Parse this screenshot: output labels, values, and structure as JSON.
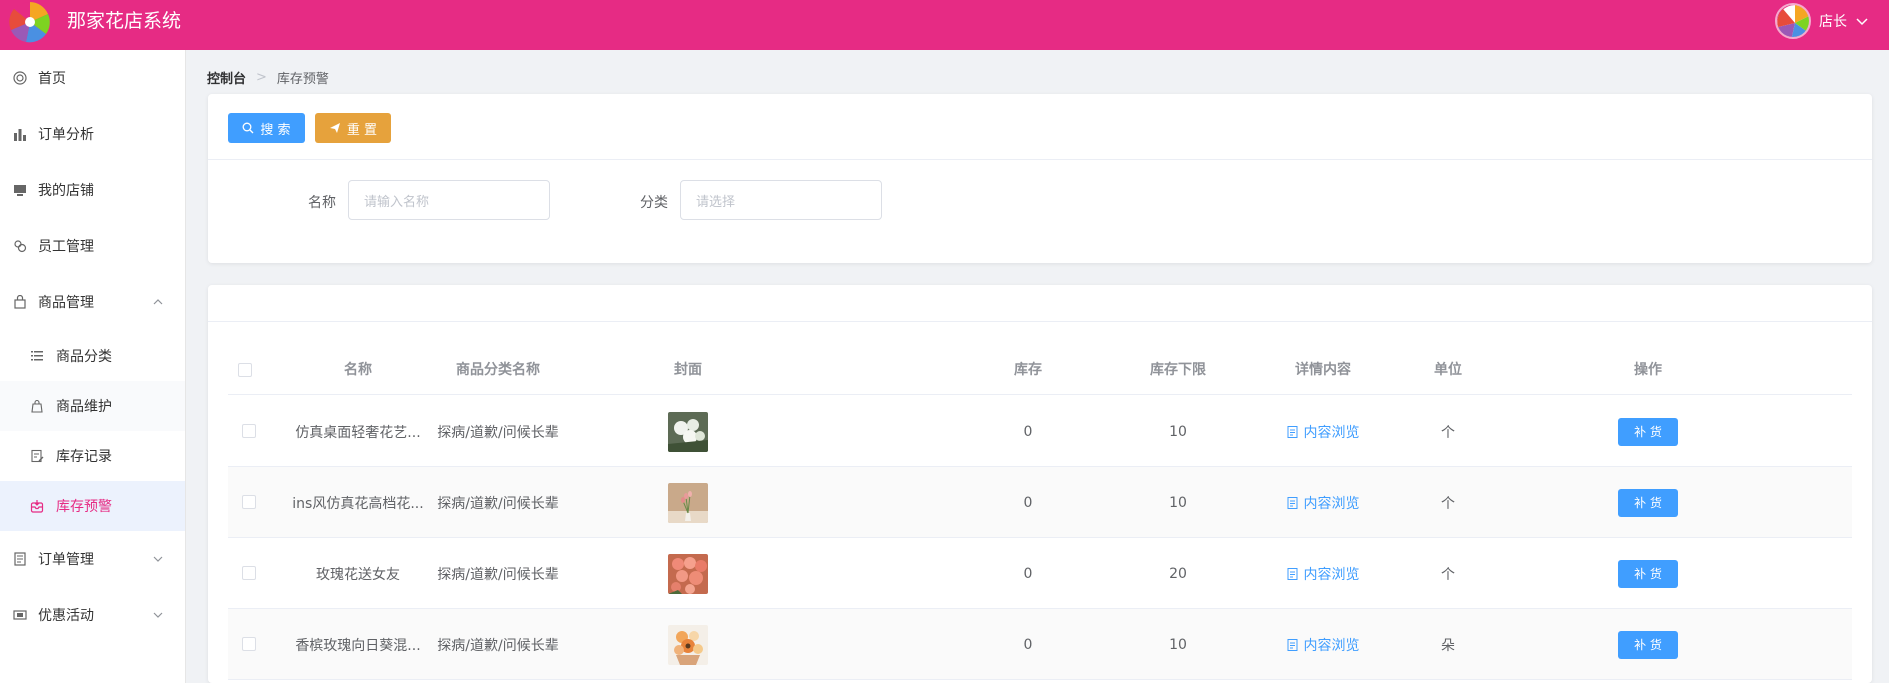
{
  "header": {
    "app_title": "那家花店系统",
    "user_name": "店长",
    "brand_color": "#e62b84"
  },
  "sidebar": {
    "items": [
      {
        "label": "首页",
        "icon": "home-icon"
      },
      {
        "label": "订单分析",
        "icon": "bar-chart-icon"
      },
      {
        "label": "我的店铺",
        "icon": "shop-icon"
      },
      {
        "label": "员工管理",
        "icon": "staff-icon"
      },
      {
        "label": "商品管理",
        "icon": "bag-icon",
        "expanded": true
      },
      {
        "label": "订单管理",
        "icon": "document-icon",
        "expanded": false
      },
      {
        "label": "优惠活动",
        "icon": "ticket-icon",
        "expanded": false
      }
    ],
    "sub_items": [
      {
        "label": "商品分类",
        "icon": "list-icon"
      },
      {
        "label": "商品维护",
        "icon": "bag-outline-icon"
      },
      {
        "label": "库存记录",
        "icon": "edit-doc-icon"
      },
      {
        "label": "库存预警",
        "icon": "inbox-icon",
        "active": true
      }
    ]
  },
  "breadcrumb": {
    "root": "控制台",
    "current": "库存预警"
  },
  "search": {
    "search_label": "搜 索",
    "reset_label": "重 置",
    "name_label": "名称",
    "name_placeholder": "请输入名称",
    "category_label": "分类",
    "category_placeholder": "请选择"
  },
  "table": {
    "columns": [
      "名称",
      "商品分类名称",
      "封面",
      "库存",
      "库存下限",
      "详情内容",
      "单位",
      "操作"
    ],
    "rows": [
      {
        "name": "仿真桌面轻奢花艺...",
        "category": "探病/道歉/问候长辈",
        "stock": "0",
        "min_stock": "10",
        "detail": "内容浏览",
        "unit": "个",
        "action": "补 货"
      },
      {
        "name": "ins风仿真花高档花...",
        "category": "探病/道歉/问候长辈",
        "stock": "0",
        "min_stock": "10",
        "detail": "内容浏览",
        "unit": "个",
        "action": "补 货"
      },
      {
        "name": "玫瑰花送女友",
        "category": "探病/道歉/问候长辈",
        "stock": "0",
        "min_stock": "20",
        "detail": "内容浏览",
        "unit": "个",
        "action": "补 货"
      },
      {
        "name": "香槟玫瑰向日葵混...",
        "category": "探病/道歉/问候长辈",
        "stock": "0",
        "min_stock": "10",
        "detail": "内容浏览",
        "unit": "朵",
        "action": "补 货"
      }
    ]
  }
}
